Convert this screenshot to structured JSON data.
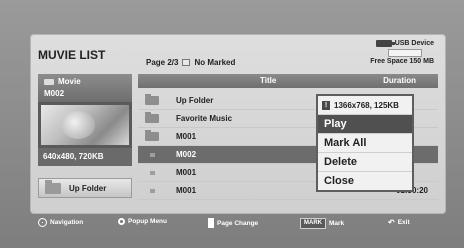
{
  "app": {
    "title": "MUVIE LIST",
    "page_info": "Page 2/3",
    "marked_label": "No Marked"
  },
  "device": {
    "usb_label": "USB Device",
    "free_space": "Free Space 150 MB"
  },
  "preview": {
    "category": "Movie",
    "file_name": "M002",
    "resolution": "640x480, 720KB",
    "up_folder_label": "Up Folder"
  },
  "list": {
    "header_title": "Title",
    "header_duration": "Duration",
    "rows": [
      {
        "type": "folder",
        "label": "Up Folder",
        "duration": ""
      },
      {
        "type": "folder",
        "label": "Favorite Music",
        "duration": ""
      },
      {
        "type": "folder",
        "label": "M001",
        "duration": ""
      },
      {
        "type": "file",
        "label": "M002",
        "duration": "",
        "selected": true
      },
      {
        "type": "file",
        "label": "M001",
        "duration": ""
      },
      {
        "type": "file",
        "label": "M001",
        "duration": "01:30:20"
      }
    ]
  },
  "popup": {
    "info": "1366x768, 125KB",
    "items": [
      "Play",
      "Mark All",
      "Delete",
      "Close"
    ],
    "active_index": 0
  },
  "footer": {
    "navigation": "Navigation",
    "popup_menu": "Popup Menu",
    "page_change": "Page Change",
    "mark_key": "MARK",
    "mark": "Mark",
    "exit": "Exit"
  }
}
